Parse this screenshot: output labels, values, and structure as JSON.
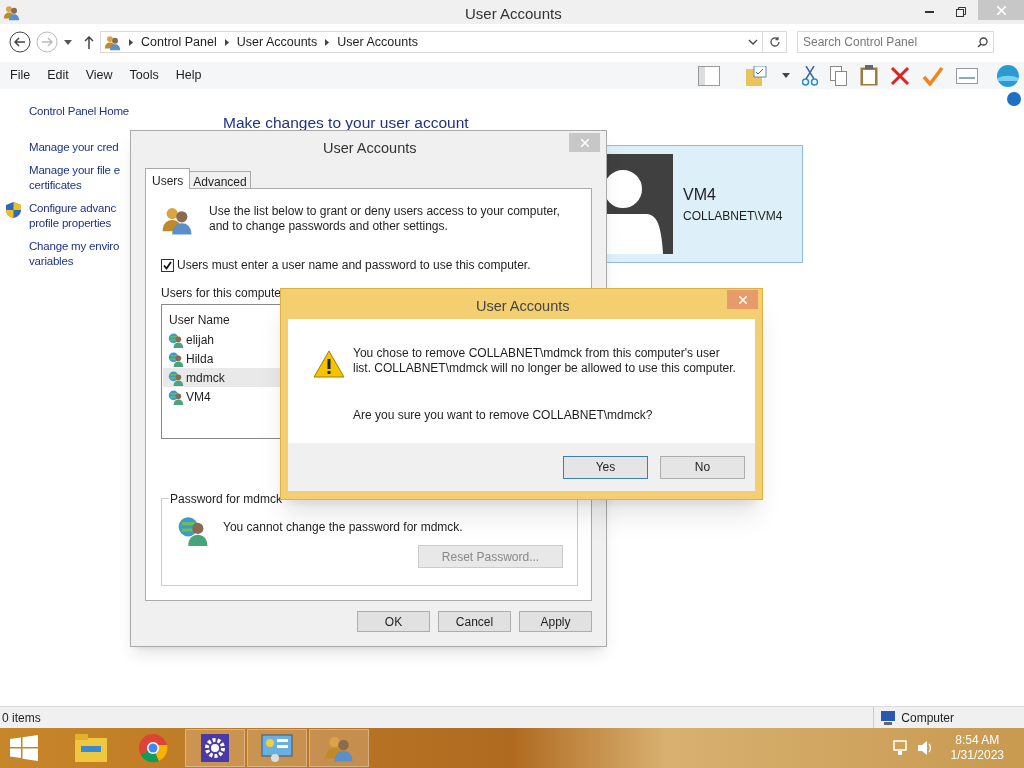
{
  "window": {
    "title": "User Accounts"
  },
  "address": {
    "crumbs": [
      "Control Panel",
      "User Accounts",
      "User Accounts"
    ],
    "search_placeholder": "Search Control Panel"
  },
  "menu": [
    "File",
    "Edit",
    "View",
    "Tools",
    "Help"
  ],
  "sidebar": {
    "items": [
      {
        "label": "Control Panel Home",
        "shield": false
      },
      {
        "label": "Manage your cred",
        "shield": false
      },
      {
        "label": "Manage your file e\ncertificates",
        "shield": false
      },
      {
        "label": "Configure advanc\nprofile properties",
        "shield": true
      },
      {
        "label": "Change my enviro\nvariables",
        "shield": false
      }
    ]
  },
  "heading": "Make changes to your user account",
  "account": {
    "name": "VM4",
    "domain": "COLLABNET\\VM4"
  },
  "dialog": {
    "title": "User Accounts",
    "tabs": [
      {
        "label": "Users",
        "selected": true
      },
      {
        "label": "Advanced",
        "selected": false
      }
    ],
    "intro": "Use the list below to grant or deny users access to your computer, and to change passwords and other settings.",
    "require_login": {
      "label": "Users must enter a user name and password to use this computer.",
      "checked": true
    },
    "list_label": "Users for this compute",
    "columns": [
      "User Name"
    ],
    "users": [
      {
        "name": "elijah",
        "selected": false
      },
      {
        "name": "Hilda",
        "selected": false
      },
      {
        "name": "mdmck",
        "selected": true
      },
      {
        "name": "VM4",
        "selected": false
      }
    ],
    "password_group": "Password for mdmck",
    "password_text": "You cannot change the password for mdmck.",
    "reset_button": "Reset Password...",
    "buttons": [
      "OK",
      "Cancel",
      "Apply"
    ]
  },
  "confirm": {
    "title": "User Accounts",
    "message": "You chose to remove COLLABNET\\mdmck from this computer's user list. COLLABNET\\mdmck will no longer be allowed to use this computer.",
    "question": "Are you sure you want to remove COLLABNET\\mdmck?",
    "buttons": [
      {
        "label": "Yes",
        "default": true
      },
      {
        "label": "No",
        "default": false
      }
    ]
  },
  "status_bar": {
    "items": "0 items",
    "location": "Computer"
  },
  "taskbar": {
    "apps": [
      {
        "kind": "explorer",
        "open": false
      },
      {
        "kind": "chrome",
        "open": false
      },
      {
        "kind": "settings",
        "open": true
      },
      {
        "kind": "control",
        "open": true
      },
      {
        "kind": "users",
        "open": true
      }
    ],
    "time": "8:54 AM",
    "date": "1/31/2023"
  }
}
